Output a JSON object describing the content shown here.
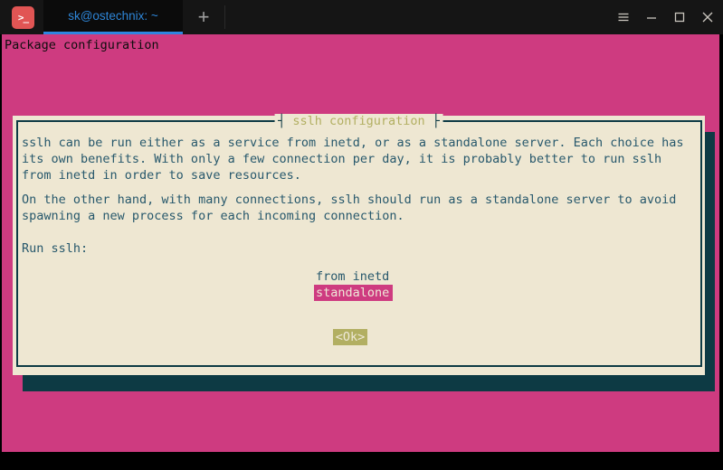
{
  "colors": {
    "screen_pink": "#CE3B80",
    "dialog_cream": "#EEE7D2",
    "dialog_border_teal": "#0D3A44",
    "dialog_text_teal": "#27586C",
    "accent_olive": "#B2AF62",
    "tab_blue": "#2E86D8",
    "terminal_icon_red": "#E15554",
    "titlebar_black": "#151515"
  },
  "titlebar": {
    "terminal_icon_glyph": ">_",
    "tab_title": "sk@ostechnix: ~",
    "new_tab_glyph": "+",
    "control_icons": [
      "menu-icon",
      "minimize-icon",
      "maximize-icon",
      "close-icon"
    ]
  },
  "terminal": {
    "status_line": "Package configuration",
    "dialog": {
      "title": "sslh configuration",
      "tee_left": "┤",
      "tee_right": "├",
      "lines": [
        "sslh can be run either as a service from inetd, or as a standalone server. Each choice has",
        "its own benefits. With only a few connection per day, it is probably better to run sslh",
        "from inetd in order to save resources.",
        "On the other hand, with many connections, sslh should run as a standalone server to avoid",
        "spawning a new process for each incoming connection."
      ],
      "prompt": "Run sslh:",
      "options": [
        {
          "label": "from inetd",
          "selected": false
        },
        {
          "label": "standalone",
          "selected": true
        }
      ],
      "ok_label": "<Ok>"
    }
  }
}
